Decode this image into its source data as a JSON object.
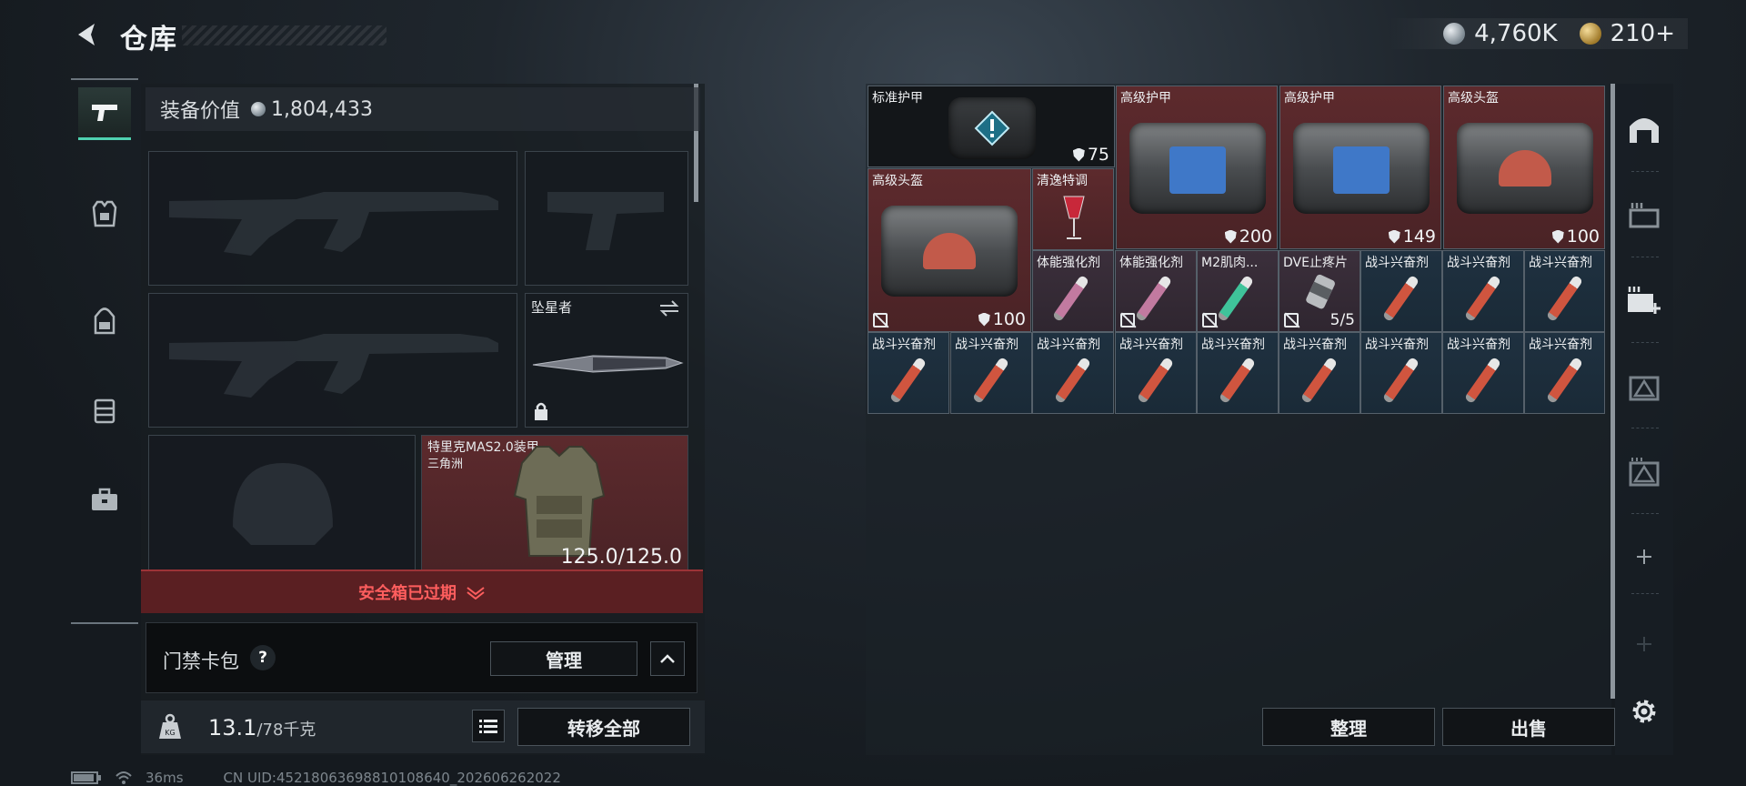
{
  "header": {
    "title": "仓库",
    "currencies": [
      {
        "icon": "silver-coin-icon",
        "value": "4,760K"
      },
      {
        "icon": "gold-coin-icon",
        "value": "210+"
      }
    ]
  },
  "equipment": {
    "value_label": "装备价值",
    "value": "1,804,433",
    "melee_name": "坠星者",
    "armor_name": "特里克MAS2.0装甲",
    "armor_sub": "三角洲",
    "armor_durability": "125.0/125.0",
    "safebox_status": "安全箱已过期"
  },
  "keycard": {
    "label": "门禁卡包",
    "help": "?",
    "manage_label": "管理"
  },
  "weight": {
    "current": "13.1",
    "max": "/78千克",
    "transfer_label": "转移全部"
  },
  "inventory": {
    "row1": [
      {
        "name": "标准护甲",
        "value": "75"
      },
      {
        "name": "高级护甲",
        "value": "200"
      },
      {
        "name": "高级护甲",
        "value": "149"
      },
      {
        "name": "高级头盔",
        "value": "100"
      }
    ],
    "helmet2": {
      "name": "高级头盔",
      "value": "100"
    },
    "drink": {
      "name": "清逸特调"
    },
    "row2": [
      {
        "name": "体能强化剂"
      },
      {
        "name": "体能强化剂"
      },
      {
        "name": "M2肌肉..."
      },
      {
        "name": "DVE止疼片",
        "value": "5/5"
      },
      {
        "name": "战斗兴奋剂"
      },
      {
        "name": "战斗兴奋剂"
      },
      {
        "name": "战斗兴奋剂"
      }
    ],
    "row3": [
      "战斗兴奋剂",
      "战斗兴奋剂",
      "战斗兴奋剂",
      "战斗兴奋剂",
      "战斗兴奋剂",
      "战斗兴奋剂",
      "战斗兴奋剂",
      "战斗兴奋剂",
      "战斗兴奋剂"
    ],
    "sort_label": "整理",
    "sell_label": "出售"
  },
  "status": {
    "ping": "36ms",
    "uid": "CN UID:45218063698810108640_202606262022"
  },
  "colors": {
    "accent": "#4fd2b0",
    "warning": "#ff5e5e",
    "red_cell": "#5d2a2d",
    "blue_cell": "#1f3140"
  }
}
